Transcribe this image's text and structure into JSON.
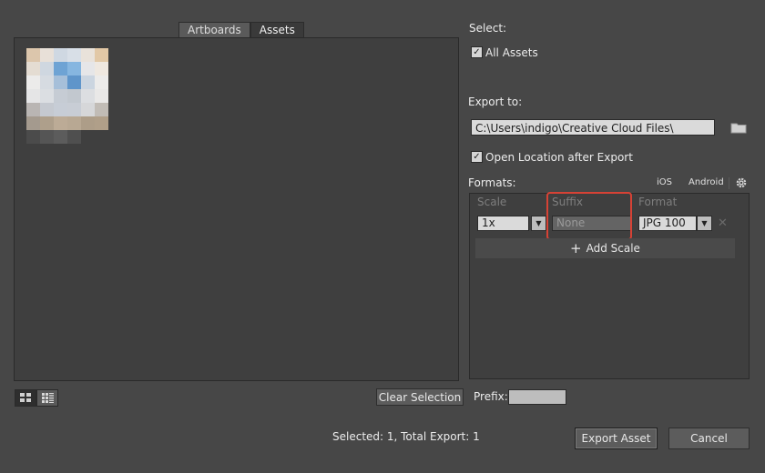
{
  "tabs": {
    "artboards": "Artboards",
    "assets": "Assets"
  },
  "thumbnail": {
    "name": "asset-thumbnail",
    "pixels": [
      "#dcc6ac",
      "#e8e0d8",
      "#cfd8e2",
      "#d8dfe7",
      "#e9e2da",
      "#e2c8a6",
      "#e4dcd2",
      "#cfd7e0",
      "#6ea3d4",
      "#86b6e0",
      "#e6e6e8",
      "#efe8e0",
      "#ecebea",
      "#d6dbe1",
      "#a6bfd9",
      "#5f95ca",
      "#cbd5e0",
      "#ecebea",
      "#e5e5e6",
      "#dbdee2",
      "#c6ccd4",
      "#c2c8cf",
      "#dcdee1",
      "#e9e8e7",
      "#b9b5b3",
      "#c5c9d0",
      "#c7cdd6",
      "#c8cdd5",
      "#d6d7d9",
      "#c1bcb6",
      "#a49a8e",
      "#ae9f8b",
      "#bcab96",
      "#b8a893",
      "#ad9d88",
      "#b09f89",
      "#4b4b4b",
      "#555555",
      "#5c5c5c",
      "#4f4f4f",
      "#3f3f3f",
      "#3f3f3f"
    ]
  },
  "view_buttons": {
    "grid": "grid-view-icon",
    "list": "list-view-icon"
  },
  "clear_selection": "Clear Selection",
  "prefix_label": "Prefix:",
  "status": "Selected: 1, Total Export: 1",
  "buttons": {
    "export": "Export Asset",
    "cancel": "Cancel"
  },
  "select": {
    "title": "Select:",
    "all_assets": "All Assets",
    "all_assets_checked": true
  },
  "export_to": {
    "title": "Export to:",
    "path": "C:\\Users\\indigo\\Creative Cloud Files\\",
    "folder_icon": "folder-icon",
    "open_location": "Open Location after Export",
    "open_location_checked": true
  },
  "formats": {
    "title": "Formats:",
    "ios": "iOS",
    "android": "Android",
    "settings_icon": "gear-icon",
    "columns": {
      "scale": "Scale",
      "suffix": "Suffix",
      "format": "Format"
    },
    "row": {
      "scale": "1x",
      "suffix_placeholder": "None",
      "format": "JPG 100"
    },
    "add_scale": "Add Scale"
  },
  "colors": {
    "highlight": "#d64235",
    "background": "#474747"
  }
}
